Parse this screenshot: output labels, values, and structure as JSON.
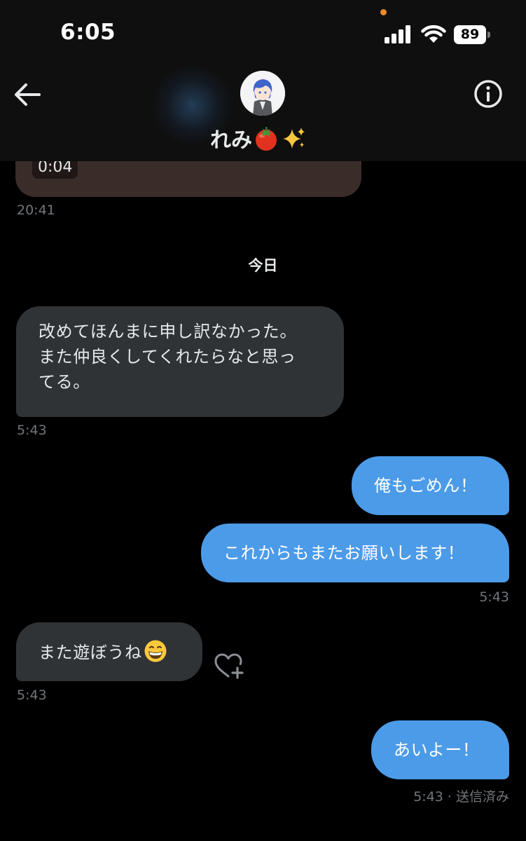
{
  "status_bar": {
    "time": "6:05",
    "battery": "89"
  },
  "header": {
    "contact_name": "れみ"
  },
  "previous_message": {
    "voice_duration": "0:04",
    "timestamp": "20:41"
  },
  "date_divider": "今日",
  "messages": [
    {
      "direction": "incoming",
      "lines": [
        "改めてほんまに申し訳なかった。",
        "また仲良くしてくれたらなと思っ",
        "てる。"
      ],
      "timestamp": "5:43"
    },
    {
      "direction": "outgoing",
      "text": "俺もごめん！"
    },
    {
      "direction": "outgoing",
      "text": "これからもまたお願いします！",
      "timestamp": "5:43"
    },
    {
      "direction": "incoming",
      "text": "また遊ぼうね",
      "emoji": "grinning-face",
      "timestamp": "5:43"
    },
    {
      "direction": "outgoing",
      "text": "あいよー！",
      "timestamp": "5:43 · 送信済み"
    }
  ],
  "icons": [
    "back-arrow-icon",
    "info-icon",
    "signal-icon",
    "wifi-icon",
    "battery-icon",
    "heart-plus-icon",
    "tomato-emoji",
    "sparkles-emoji",
    "grinning-face-emoji"
  ],
  "colors": {
    "background": "#000000",
    "incoming_bubble": "#2f3336",
    "outgoing_bubble": "#4c9be8",
    "timestamp": "#71767b",
    "voice_bubble": "#3a2c29"
  }
}
